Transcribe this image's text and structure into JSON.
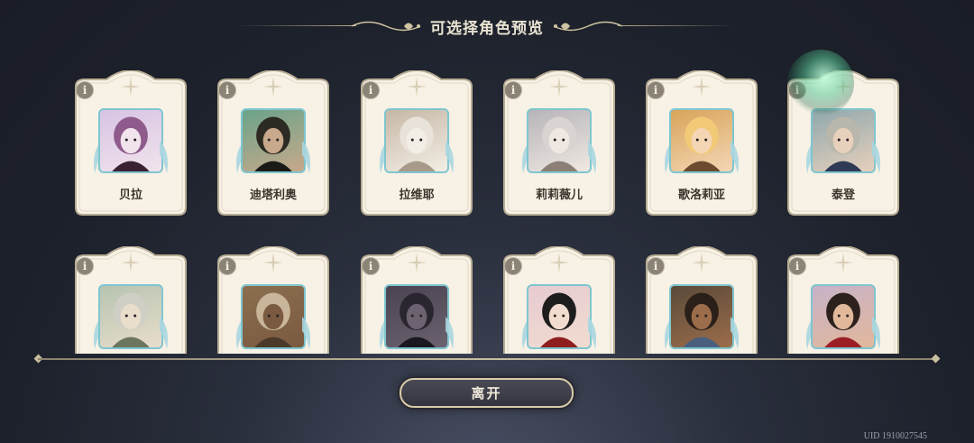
{
  "header": {
    "title": "可选择角色预览"
  },
  "characters_row1": [
    {
      "name": "贝拉",
      "palette": [
        "#d7c3e4",
        "#8e5b8c",
        "#3b2233",
        "#f1e4ec"
      ]
    },
    {
      "name": "迪塔利奥",
      "palette": [
        "#6aa38a",
        "#2c2a22",
        "#1a1a16",
        "#c8a98b"
      ]
    },
    {
      "name": "拉维耶",
      "palette": [
        "#c6b7a6",
        "#e8e2d8",
        "#a89a8a",
        "#f3eee5"
      ]
    },
    {
      "name": "莉莉薇儿",
      "palette": [
        "#b7b4b9",
        "#d9d4d2",
        "#8b7f76",
        "#efe8e2"
      ]
    },
    {
      "name": "歌洛莉亚",
      "palette": [
        "#d8a45a",
        "#f2c977",
        "#6b4a2e",
        "#f4d6b5"
      ]
    },
    {
      "name": "泰登",
      "palette": [
        "#8fa8ad",
        "#b9b6ab",
        "#2f3b55",
        "#e7d0bc"
      ]
    }
  ],
  "characters_row2": [
    {
      "name": "",
      "palette": [
        "#b6c4b0",
        "#d0cfc6",
        "#6c7560",
        "#e9ddcc"
      ]
    },
    {
      "name": "",
      "palette": [
        "#8b6e4f",
        "#c8b59a",
        "#4b3a2a",
        "#7a5a40"
      ]
    },
    {
      "name": "",
      "palette": [
        "#4a4350",
        "#2a2630",
        "#1b1820",
        "#6c6270"
      ]
    },
    {
      "name": "",
      "palette": [
        "#e7cbd2",
        "#1d1d1d",
        "#8e1e1e",
        "#f1dccf"
      ]
    },
    {
      "name": "",
      "palette": [
        "#5a4a3a",
        "#2b2019",
        "#4a5f7e",
        "#9c6d4a"
      ]
    },
    {
      "name": "",
      "palette": [
        "#c7b2c9",
        "#2c211c",
        "#9d1f26",
        "#e2b89b"
      ]
    }
  ],
  "info_icon_text": "i",
  "footer": {
    "leave_label": "离开",
    "uid": "UID 1910027545"
  },
  "colors": {
    "card_bg": "#f7f1e6",
    "card_border": "#b8ad94",
    "portrait_border": "#7fc6cf",
    "accent_gold": "#c9bf9f"
  }
}
